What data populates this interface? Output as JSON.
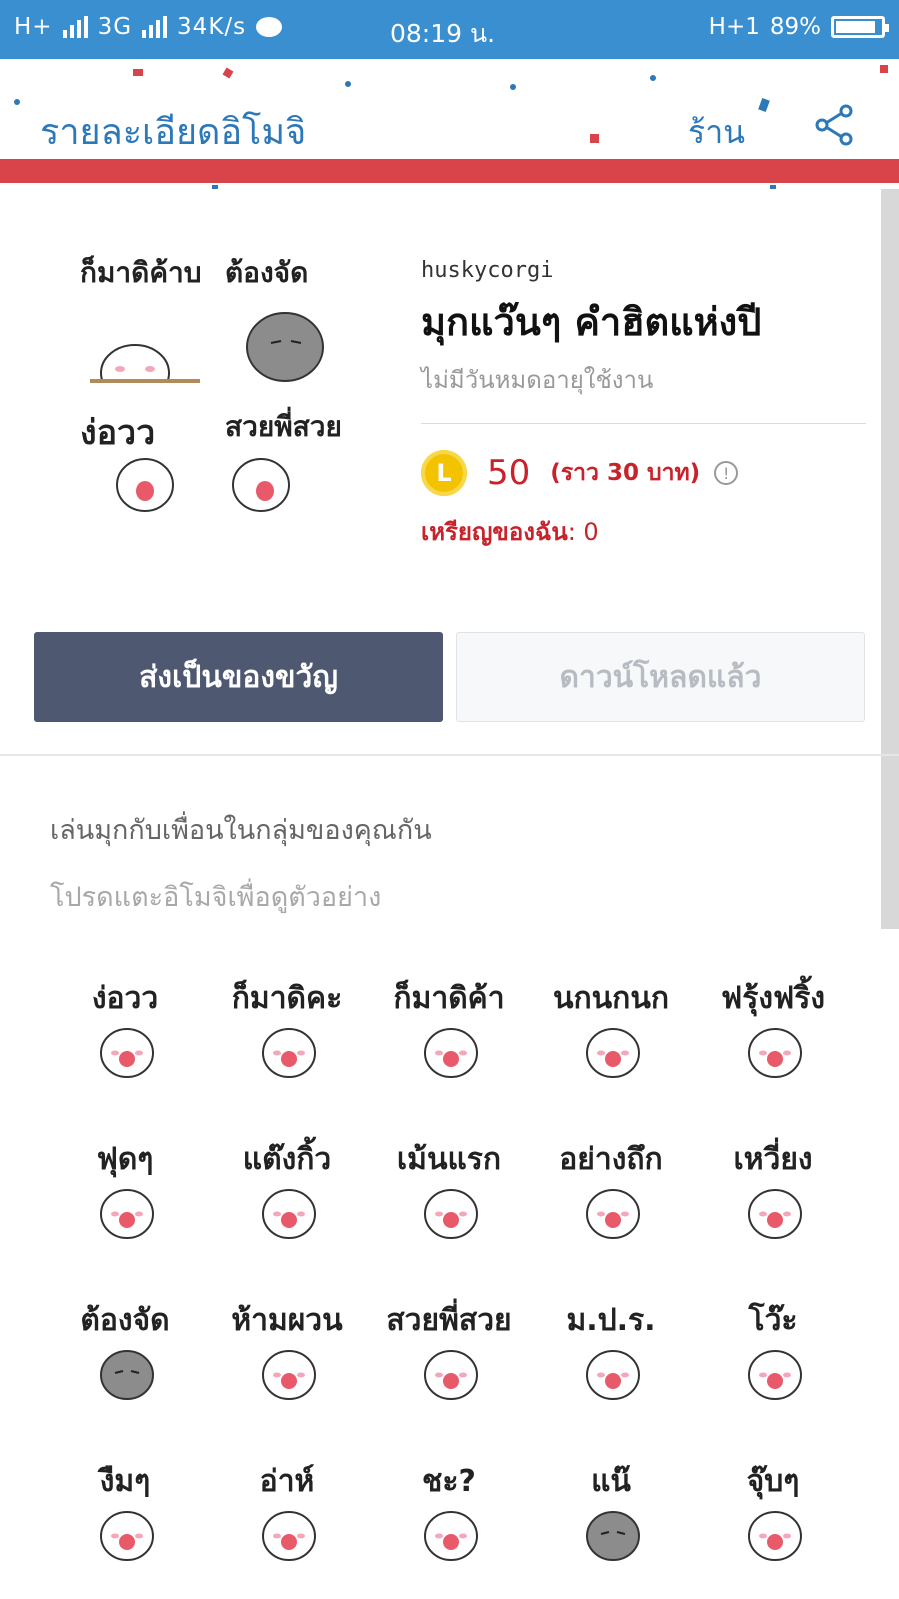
{
  "status_bar": {
    "network1": "H+",
    "network2": "3G",
    "speed": "34K/s",
    "time": "08:19 น.",
    "network_right": "H+1",
    "battery": "89%",
    "battery_level": 0.89
  },
  "header": {
    "title": "รายละเอียดอิโมจิ",
    "shop_label": "ร้าน",
    "share_icon": "share-icon"
  },
  "pack": {
    "author": "huskycorgi",
    "title": "มุกแว๊นๆ คำฮิตแห่งปี",
    "validity": "ไม่มีวันหมดอายุใช้งาน",
    "coin_letter": "L",
    "price": "50",
    "approx_price": "(ราว 30 บาท)",
    "info_icon": "!",
    "my_coins_label": "เหรียญของฉัน",
    "my_coins_value": ": 0",
    "preview": [
      {
        "label": "ก็มาดิค้าบ"
      },
      {
        "label": "ต้องจัด"
      },
      {
        "label": "ง่อวว"
      },
      {
        "label": "สวยพี่สวย"
      }
    ]
  },
  "buttons": {
    "gift": "ส่งเป็นของขวัญ",
    "downloaded": "ดาวน์โหลดแล้ว"
  },
  "description": {
    "line1": "เล่นมุกกับเพื่อนในกลุ่มของคุณกัน",
    "line2": "โปรดแตะอิโมจิเพื่อดูตัวอย่าง"
  },
  "stickers": [
    {
      "label": "ง่อวว",
      "face": "white"
    },
    {
      "label": "ก็มาดิคะ",
      "face": "white"
    },
    {
      "label": "ก็มาดิค้าบ",
      "face": "white"
    },
    {
      "label": "นกนกนก",
      "face": "white"
    },
    {
      "label": "ฟรุ้งฟริ้ง",
      "face": "white"
    },
    {
      "label": "ฟุดๆ",
      "face": "white"
    },
    {
      "label": "แต๊งกิ้ว",
      "face": "white"
    },
    {
      "label": "เม้นแรก",
      "face": "white"
    },
    {
      "label": "อย่างถึก",
      "face": "white"
    },
    {
      "label": "เหวี่ยง",
      "face": "white"
    },
    {
      "label": "ต้องจัด",
      "face": "gray"
    },
    {
      "label": "ห้ามผวน",
      "face": "white"
    },
    {
      "label": "สวยพี่สวย",
      "face": "white"
    },
    {
      "label": "ม.ป.ร.",
      "face": "white"
    },
    {
      "label": "โว๊ะ",
      "face": "white"
    },
    {
      "label": "งืมๆ",
      "face": "white"
    },
    {
      "label": "อ่าห์",
      "face": "white"
    },
    {
      "label": "ชะ?",
      "face": "white"
    },
    {
      "label": "แน๊",
      "face": "gray"
    },
    {
      "label": "จุ๊บๆ",
      "face": "white"
    }
  ],
  "colors": {
    "status_bar": "#3a8fd0",
    "header_text": "#2c78b8",
    "stripe": "#d9434a",
    "gift_button": "#4e5871",
    "price": "#c8222b",
    "coin": "#f4c300"
  }
}
